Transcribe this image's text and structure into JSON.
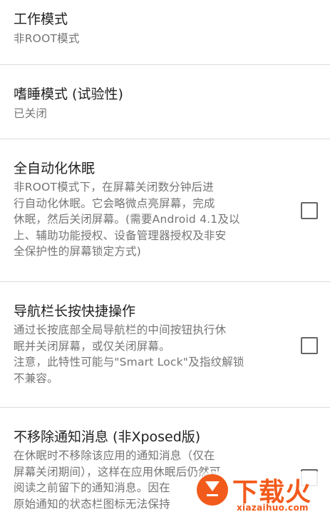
{
  "preferences": [
    {
      "title": "工作模式",
      "summary_lines": [
        "非ROOT模式"
      ],
      "has_checkbox": false
    },
    {
      "title": "嗜睡模式 (试验性)",
      "summary_lines": [
        "已关闭"
      ],
      "has_checkbox": false
    },
    {
      "title": "全自动化休眠",
      "summary_lines": [
        "非ROOT模式下，在屏幕关闭数分钟后进",
        "行自动化休眠。它会略微点亮屏幕，完成",
        "休眠，然后关闭屏幕。(需要Android 4.1及以",
        "上、辅助功能授权、设备管理器授权及非安",
        "全保护性的屏幕锁定方式)"
      ],
      "has_checkbox": true,
      "checked": false
    },
    {
      "title": "导航栏长按快捷操作",
      "summary_lines": [
        "通过长按底部全局导航栏的中间按钮执行休",
        "眠并关闭屏幕，或仅关闭屏幕。",
        "注意，此特性可能与\"Smart Lock\"及指纹解锁",
        "不兼容。"
      ],
      "has_checkbox": true,
      "checked": false
    },
    {
      "title": "不移除通知消息 (非Xposed版)",
      "summary_lines": [
        "在休眠时不移除该应用的通知消息（仅在",
        "屏幕关闭期间），这样在应用休眠后仍然可",
        "阅读之前留下的通知消息。因在",
        "原始通知的状态栏图标无法保持"
      ],
      "has_checkbox": true,
      "checked": false
    }
  ],
  "watermark": {
    "text": "下载火",
    "domain": "xiazaihuo.com"
  },
  "colors": {
    "title": "#212121",
    "summary": "#757575",
    "divider": "#dcdcdc",
    "watermark": "#f25a1b"
  }
}
